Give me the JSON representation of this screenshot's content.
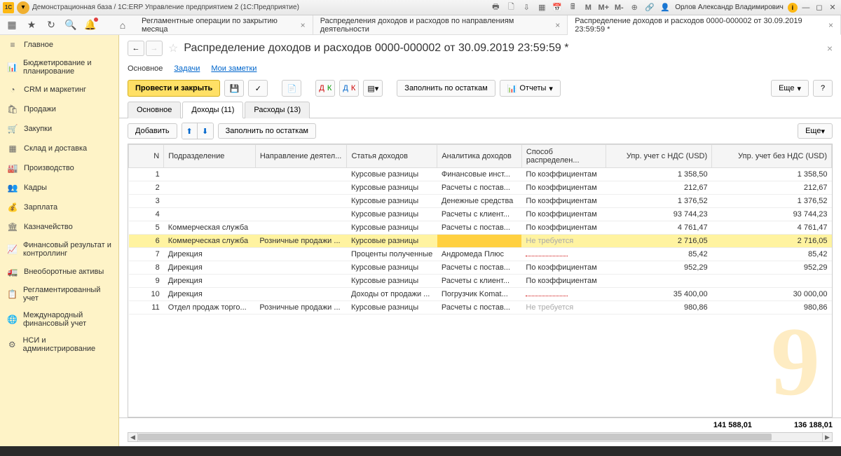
{
  "titlebar": {
    "app_title": "Демонстрационная база / 1С:ERP Управление предприятием 2  (1С:Предприятие)",
    "user": "Орлов Александр Владимирович"
  },
  "toolstrip_tabs": [
    "Регламентные операции по закрытию месяца",
    "Распределения доходов и расходов по направлениям деятельности",
    "Распределение доходов и расходов  0000-000002 от 30.09.2019 23:59:59 *"
  ],
  "sidebar": {
    "items": [
      {
        "icon": "≡",
        "label": "Главное"
      },
      {
        "icon": "📊",
        "label": "Бюджетирование и планирование"
      },
      {
        "icon": "◔",
        "label": "CRM и маркетинг"
      },
      {
        "icon": "🛍",
        "label": "Продажи"
      },
      {
        "icon": "🛒",
        "label": "Закупки"
      },
      {
        "icon": "▦",
        "label": "Склад и доставка"
      },
      {
        "icon": "🏭",
        "label": "Производство"
      },
      {
        "icon": "👥",
        "label": "Кадры"
      },
      {
        "icon": "💰",
        "label": "Зарплата"
      },
      {
        "icon": "🏛",
        "label": "Казначейство"
      },
      {
        "icon": "📈",
        "label": "Финансовый результат и контроллинг"
      },
      {
        "icon": "🚛",
        "label": "Внеоборотные активы"
      },
      {
        "icon": "📋",
        "label": "Регламентированный учет"
      },
      {
        "icon": "🌐",
        "label": "Международный финансовый учет"
      },
      {
        "icon": "⚙",
        "label": "НСИ и администрирование"
      }
    ]
  },
  "doc": {
    "title": "Распределение доходов и расходов  0000-000002 от 30.09.2019 23:59:59 *",
    "inline_tabs": [
      "Основное",
      "Задачи",
      "Мои заметки"
    ],
    "actions": {
      "post_and_close": "Провести и закрыть",
      "fill_balances": "Заполнить по остаткам",
      "reports": "Отчеты",
      "more": "Еще",
      "help": "?"
    },
    "sub_tabs": [
      "Основное",
      "Доходы (11)",
      "Расходы (13)"
    ],
    "table_toolbar": {
      "add": "Добавить",
      "fill_balances": "Заполнить по остаткам",
      "more": "Еще"
    },
    "columns": [
      "N",
      "Подразделение",
      "Направление деятел...",
      "Статья доходов",
      "Аналитика доходов",
      "Способ распределен...",
      "Упр. учет с НДС (USD)",
      "Упр. учет без НДС (USD)"
    ],
    "rows": [
      {
        "n": "1",
        "dept": "",
        "dir": "",
        "it": "Курсовые разницы",
        "an": "Финансовые инст...",
        "me": "По коэффициентам",
        "v1": "1 358,50",
        "v2": "1 358,50"
      },
      {
        "n": "2",
        "dept": "",
        "dir": "",
        "it": "Курсовые разницы",
        "an": "Расчеты с постав...",
        "me": "По коэффициентам",
        "v1": "212,67",
        "v2": "212,67"
      },
      {
        "n": "3",
        "dept": "",
        "dir": "",
        "it": "Курсовые разницы",
        "an": "Денежные средства",
        "me": "По коэффициентам",
        "v1": "1 376,52",
        "v2": "1 376,52"
      },
      {
        "n": "4",
        "dept": "",
        "dir": "",
        "it": "Курсовые разницы",
        "an": "Расчеты с клиент...",
        "me": "По коэффициентам",
        "v1": "93 744,23",
        "v2": "93 744,23"
      },
      {
        "n": "5",
        "dept": "Коммерческая служба",
        "dir": "",
        "it": "Курсовые разницы",
        "an": "Расчеты с постав...",
        "me": "По коэффициентам",
        "v1": "4 761,47",
        "v2": "4 761,47"
      },
      {
        "n": "6",
        "dept": "Коммерческая служба",
        "dir": "Розничные продажи ...",
        "it": "Курсовые разницы",
        "an": "",
        "me": "Не требуется",
        "me_muted": true,
        "v1": "2 716,05",
        "v2": "2 716,05",
        "selected": true
      },
      {
        "n": "7",
        "dept": "Дирекция",
        "dir": "",
        "it": "Проценты полученные",
        "an": "Андромеда Плюс",
        "me": "",
        "me_dotted": true,
        "v1": "85,42",
        "v2": "85,42"
      },
      {
        "n": "8",
        "dept": "Дирекция",
        "dir": "",
        "it": "Курсовые разницы",
        "an": "Расчеты с постав...",
        "me": "По коэффициентам",
        "v1": "952,29",
        "v2": "952,29"
      },
      {
        "n": "9",
        "dept": "Дирекция",
        "dir": "",
        "it": "Курсовые разницы",
        "an": "Расчеты с клиент...",
        "me": "По коэффициентам",
        "v1": "",
        "v2": ""
      },
      {
        "n": "10",
        "dept": "Дирекция",
        "dir": "",
        "it": "Доходы от продажи ...",
        "an": "Погрузчик Komat...",
        "me": "",
        "me_dotted": true,
        "v1": "35 400,00",
        "v2": "30 000,00"
      },
      {
        "n": "11",
        "dept": "Отдел продаж торго...",
        "dir": "Розничные продажи ...",
        "it": "Курсовые разницы",
        "an": "Расчеты с постав...",
        "me": "Не требуется",
        "me_muted": true,
        "v1": "980,86",
        "v2": "980,86"
      }
    ],
    "totals": {
      "v1": "141 588,01",
      "v2": "136 188,01"
    }
  }
}
